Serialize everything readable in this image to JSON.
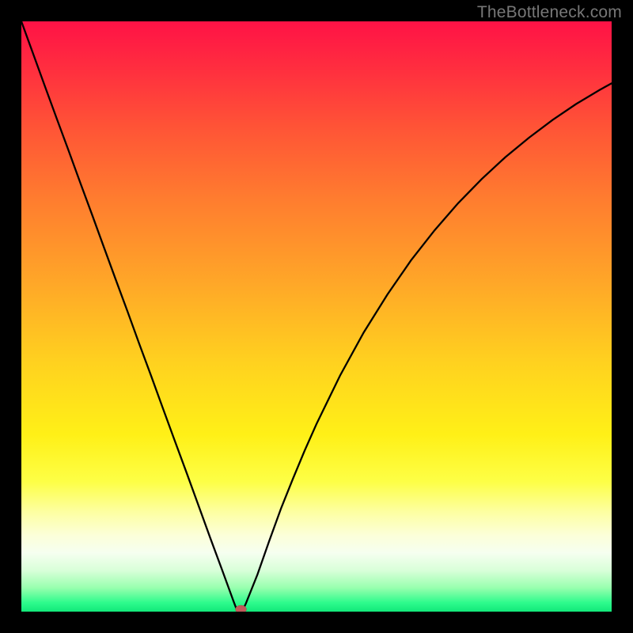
{
  "watermark": "TheBottleneck.com",
  "chart_data": {
    "type": "line",
    "title": "",
    "xlabel": "",
    "ylabel": "",
    "x": [
      0.0,
      0.02,
      0.04,
      0.06,
      0.08,
      0.1,
      0.12,
      0.14,
      0.16,
      0.18,
      0.2,
      0.22,
      0.24,
      0.26,
      0.28,
      0.3,
      0.32,
      0.34,
      0.36,
      0.365,
      0.37,
      0.375,
      0.38,
      0.4,
      0.42,
      0.44,
      0.46,
      0.48,
      0.5,
      0.54,
      0.58,
      0.62,
      0.66,
      0.7,
      0.74,
      0.78,
      0.82,
      0.86,
      0.9,
      0.94,
      0.98,
      1.0
    ],
    "values": [
      100.0,
      94.5,
      89.0,
      83.5,
      78.1,
      72.6,
      67.2,
      61.7,
      56.2,
      50.8,
      45.3,
      39.9,
      34.4,
      28.9,
      23.5,
      18.0,
      12.5,
      7.1,
      1.6,
      0.3,
      0.0,
      0.3,
      1.3,
      6.3,
      12.0,
      17.5,
      22.5,
      27.3,
      31.8,
      40.0,
      47.3,
      53.7,
      59.5,
      64.6,
      69.2,
      73.3,
      77.0,
      80.3,
      83.3,
      86.0,
      88.4,
      89.5
    ],
    "xlim": [
      0,
      1
    ],
    "ylim": [
      0,
      100
    ],
    "marker": {
      "x": 0.372,
      "y": 0.0
    },
    "grid": false,
    "legend": false
  },
  "colors": {
    "top": "#ff1246",
    "bottom": "#12e87a",
    "curve": "#000000",
    "marker": "#c05a5a",
    "frame": "#000000"
  }
}
